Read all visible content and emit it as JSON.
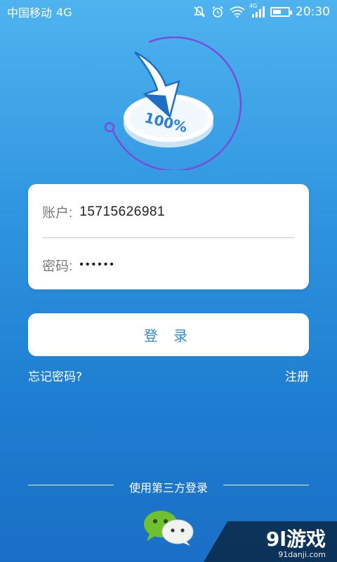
{
  "status_bar": {
    "carrier": "中国移动",
    "network": "4G",
    "signal_network": "4G",
    "time": "20:30",
    "icons": [
      "mute-icon",
      "alarm-icon",
      "wifi-icon",
      "signal-icon",
      "battery-icon"
    ],
    "battery_level": 0.55
  },
  "logo": {
    "percent_text": "100%",
    "accent_color": "#7a4cd9"
  },
  "form": {
    "account_label": "账户:",
    "account_value": "15715626981",
    "password_label": "密码:",
    "password_mask": "••••••"
  },
  "actions": {
    "login_label": "登 录",
    "forgot_label": "忘记密码?",
    "register_label": "注册"
  },
  "third_party": {
    "title": "使用第三方登录",
    "providers": [
      "wechat-icon"
    ]
  },
  "watermark": {
    "brand": "9l游戏",
    "domain": "91danji.com"
  },
  "colors": {
    "bg_top": "#4fb3ef",
    "bg_bottom": "#1a6fc5",
    "button_text": "#2e8ad6",
    "wechat_green": "#6fc12f"
  }
}
